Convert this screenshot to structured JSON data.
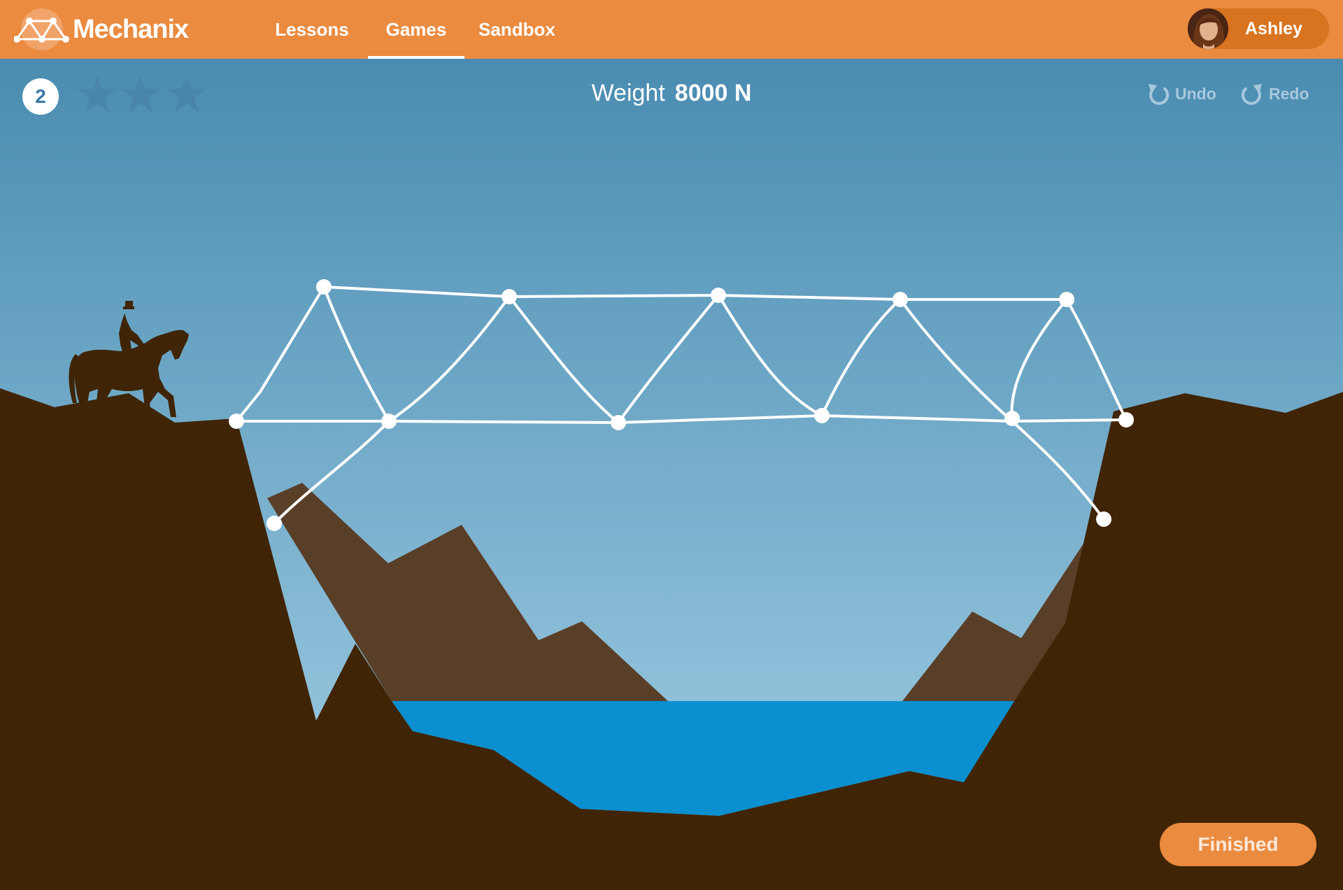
{
  "app": {
    "brand": "Mechanix"
  },
  "nav": {
    "lessons": "Lessons",
    "games": "Games",
    "sandbox": "Sandbox",
    "active": "Games"
  },
  "user": {
    "name": "Ashley"
  },
  "hud": {
    "level": "2",
    "stars_earned": 0,
    "stars_total": 3,
    "weight_label": "Weight",
    "weight_value": "8000 N"
  },
  "toolbar": {
    "undo": "Undo",
    "redo": "Redo"
  },
  "actions": {
    "finished": "Finished"
  },
  "colors": {
    "topbar": "#ea8b40",
    "sky_top": "#4a8cb1",
    "sky_bottom": "#a3d0e6",
    "ground": "#3f2405",
    "mountains": "#5a3f28",
    "water": "#0a8fd0",
    "truss": "#ffffff"
  },
  "icons": [
    "mechanix-logo-icon",
    "star-icon",
    "undo-icon",
    "redo-icon",
    "horse-rider-silhouette"
  ]
}
